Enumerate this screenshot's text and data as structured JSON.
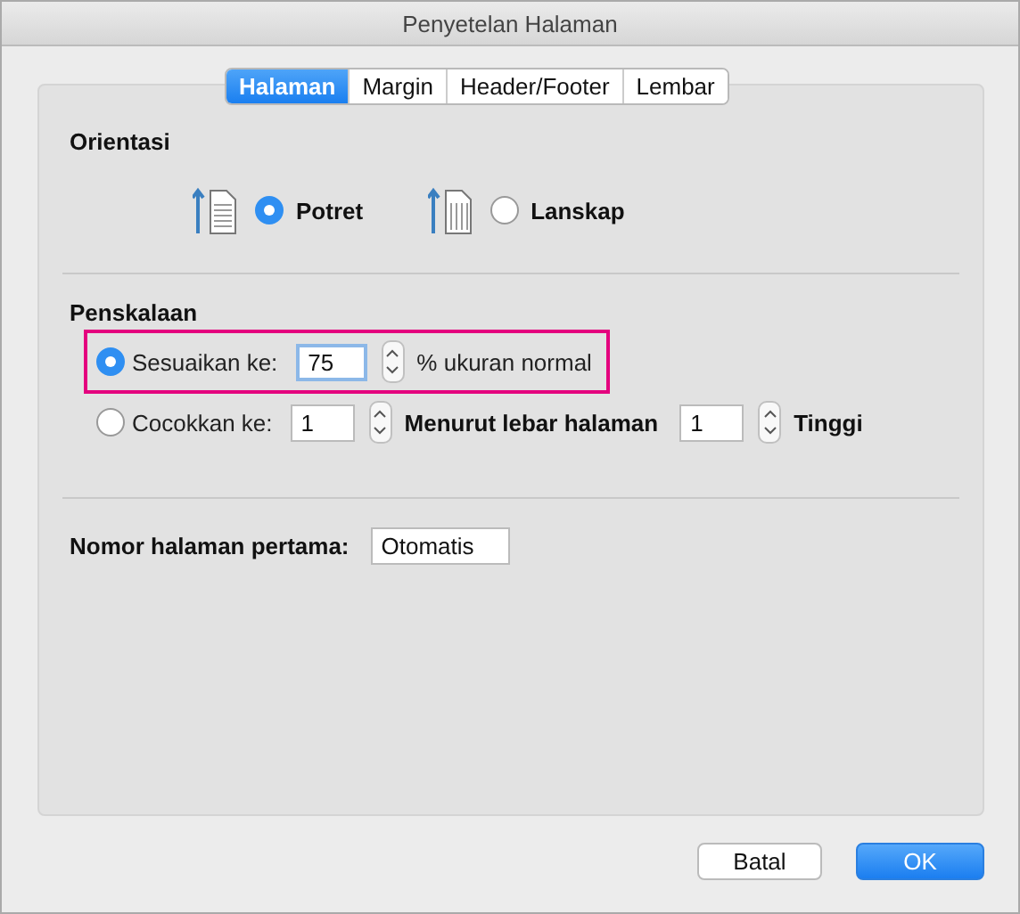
{
  "window": {
    "title": "Penyetelan Halaman"
  },
  "tabs": [
    {
      "label": "Halaman",
      "selected": true
    },
    {
      "label": "Margin",
      "selected": false
    },
    {
      "label": "Header/Footer",
      "selected": false
    },
    {
      "label": "Lembar",
      "selected": false
    }
  ],
  "orientation": {
    "heading": "Orientasi",
    "options": [
      {
        "label": "Potret",
        "kind": "portrait",
        "selected": true
      },
      {
        "label": "Lanskap",
        "kind": "landscape",
        "selected": false
      }
    ]
  },
  "scaling": {
    "heading": "Penskalaan",
    "adjust": {
      "label": "Sesuaikan ke:",
      "selected": true,
      "value": "75",
      "suffix": "% ukuran normal",
      "highlighted": true
    },
    "fit": {
      "label": "Cocokkan ke:",
      "selected": false,
      "wide_value": "1",
      "wide_label": "Menurut lebar halaman",
      "tall_value": "1",
      "tall_label": "Tinggi"
    }
  },
  "first_page": {
    "label": "Nomor halaman pertama:",
    "value": "Otomatis"
  },
  "buttons": [
    {
      "label": "Batal",
      "kind": "default"
    },
    {
      "label": "OK",
      "kind": "primary"
    }
  ]
}
